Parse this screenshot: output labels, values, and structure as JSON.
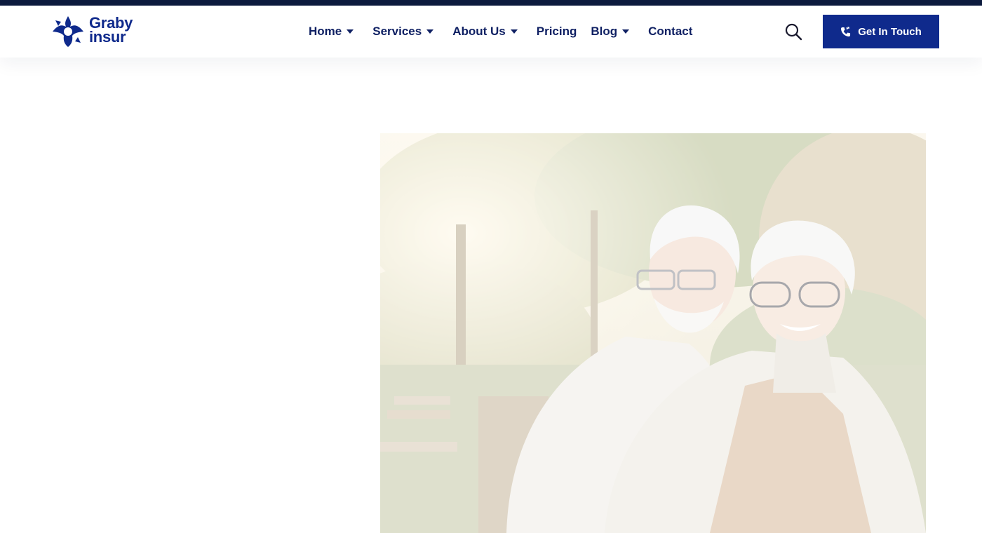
{
  "brand": {
    "name_line1": "Graby",
    "name_line2": "insur",
    "color": "#0f2a8c",
    "icon": "brand-cross-icon"
  },
  "nav": {
    "items": [
      {
        "label": "Home",
        "has_dropdown": true,
        "active": true
      },
      {
        "label": "Services",
        "has_dropdown": true
      },
      {
        "label": "About Us",
        "has_dropdown": true
      },
      {
        "label": "Pricing",
        "has_dropdown": false
      },
      {
        "label": "Blog",
        "has_dropdown": true
      },
      {
        "label": "Contact",
        "has_dropdown": false
      }
    ]
  },
  "header": {
    "search_icon": "search-icon",
    "cta_label": "Get In Touch",
    "cta_icon": "phone-icon"
  },
  "hero": {
    "image": "elderly-couple-smiling-park-photo"
  },
  "colors": {
    "topbar": "#0d1b3e",
    "primary": "#0f2a8c",
    "nav_text": "#0f2063"
  }
}
